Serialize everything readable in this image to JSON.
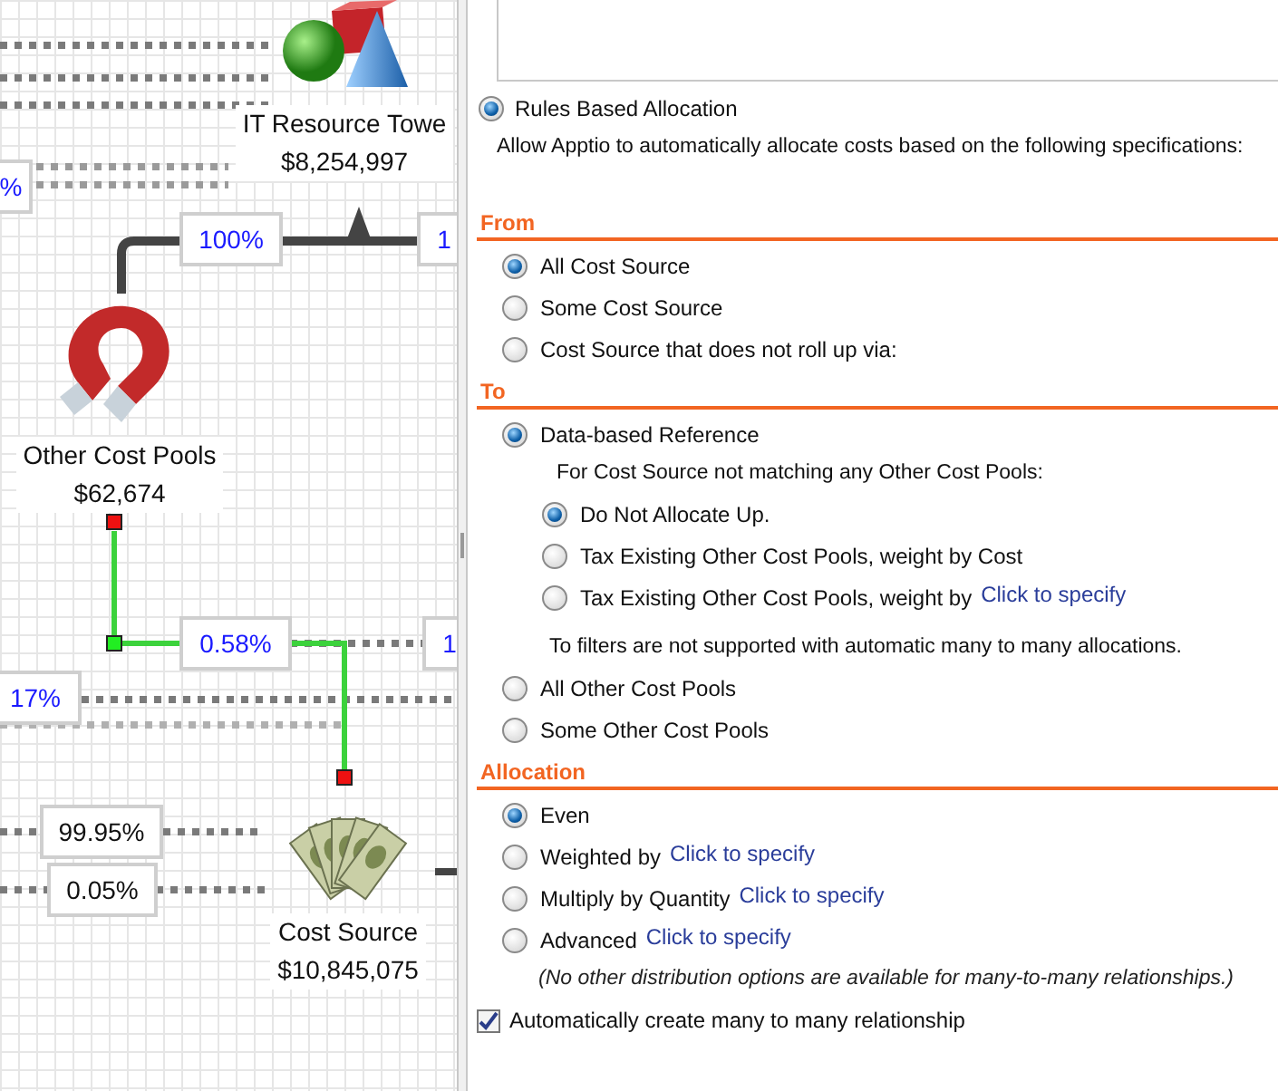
{
  "canvas": {
    "nodes": [
      {
        "kind": "shapes",
        "name": "IT Resource Towe",
        "amount": "$8,254,997"
      },
      {
        "kind": "magnet",
        "name": "Other Cost Pools",
        "amount": "$62,674"
      },
      {
        "kind": "money",
        "name": "Cost Source",
        "amount": "$10,845,075"
      }
    ],
    "edge_labels": [
      {
        "text": "%",
        "kind": "linked"
      },
      {
        "text": "100%",
        "kind": "linked"
      },
      {
        "text": "1",
        "kind": "linked"
      },
      {
        "text": "0.58%",
        "kind": "linked"
      },
      {
        "text": "1",
        "kind": "linked"
      },
      {
        "text": "17%",
        "kind": "linked"
      },
      {
        "text": "99.95%",
        "kind": "plain"
      },
      {
        "text": "0.05%",
        "kind": "plain"
      }
    ]
  },
  "panel": {
    "method": {
      "label": "Rules Based Allocation",
      "selected": true
    },
    "description": "Allow Apptio to automatically allocate costs based on the following specifications:",
    "sections": [
      {
        "title": "From",
        "items": [
          {
            "kind": "radio",
            "label": "All Cost Source",
            "selected": true
          },
          {
            "kind": "radio",
            "label": "Some Cost Source",
            "selected": false
          },
          {
            "kind": "radio",
            "label": "Cost Source that does not roll up via:",
            "selected": false
          }
        ]
      },
      {
        "title": "To",
        "items": [
          {
            "kind": "radio",
            "label": "Data-based Reference",
            "selected": true,
            "children": [
              {
                "kind": "note",
                "label": "For Cost Source not matching any Other Cost Pools:"
              },
              {
                "kind": "radio",
                "label": "Do Not Allocate Up.",
                "selected": true
              },
              {
                "kind": "radio",
                "label": "Tax Existing Other Cost Pools, weight by Cost",
                "selected": false
              },
              {
                "kind": "radio",
                "label": "Tax Existing Other Cost Pools, weight by",
                "link": "Click to specify",
                "selected": false
              },
              {
                "kind": "note",
                "label": "To filters are not supported with automatic many to many allocations."
              }
            ]
          },
          {
            "kind": "radio",
            "label": "All Other Cost Pools",
            "selected": false
          },
          {
            "kind": "radio",
            "label": "Some Other Cost Pools",
            "selected": false
          }
        ]
      },
      {
        "title": "Allocation",
        "items": [
          {
            "kind": "radio",
            "label": "Even",
            "selected": true
          },
          {
            "kind": "radio",
            "label": "Weighted by",
            "link": "Click to specify",
            "selected": false
          },
          {
            "kind": "radio",
            "label": "Multiply by Quantity",
            "link": "Click to specify",
            "selected": false
          },
          {
            "kind": "radio",
            "label": "Advanced",
            "link": "Click to specify",
            "selected": false
          },
          {
            "kind": "hint",
            "label": "(No other distribution options are available for many-to-many relationships.)"
          }
        ]
      }
    ],
    "auto_create": {
      "label": "Automatically create many to many relationship",
      "checked": true
    }
  }
}
